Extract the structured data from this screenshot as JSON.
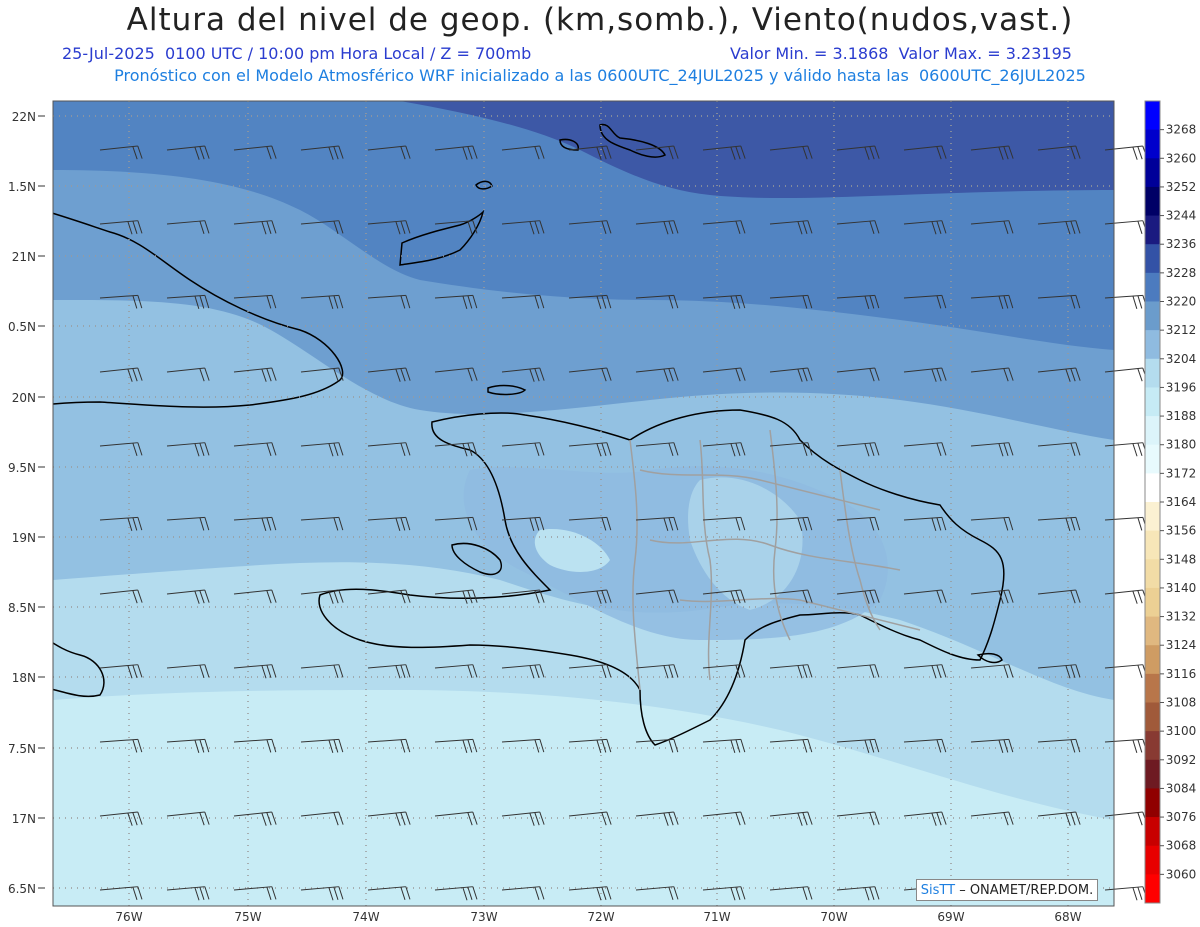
{
  "header": {
    "title": "Altura del nivel de geop. (km,somb.), Viento(nudos,vast.)",
    "line1_left": "25-Jul-2025  0100 UTC / 10:00 pm Hora Local / Z = 700mb",
    "line1_right": "Valor Min. = 3.1868  Valor Max. = 3.23195",
    "line2": "Pronóstico con el Modelo Atmosférico WRF inicializado a las 0600UTC_24JUL2025 y válido hasta las  0600UTC_26JUL2025"
  },
  "axes": {
    "lat_labels": [
      "22N",
      "1.5N",
      "21N",
      "0.5N",
      "20N",
      "9.5N",
      "19N",
      "8.5N",
      "18N",
      "7.5N",
      "17N",
      "6.5N"
    ],
    "lon_labels": [
      "76W",
      "75W",
      "74W",
      "73W",
      "72W",
      "71W",
      "70W",
      "69W",
      "68W"
    ]
  },
  "colorbar": {
    "labels": [
      "3268",
      "3260",
      "3252",
      "3244",
      "3236",
      "3228",
      "3220",
      "3212",
      "3204",
      "3196",
      "3188",
      "3180",
      "3172",
      "3164",
      "3156",
      "3148",
      "3140",
      "3132",
      "3124",
      "3116",
      "3108",
      "3100",
      "3092",
      "3084",
      "3076",
      "3068",
      "3060"
    ],
    "colors": [
      "#0000ff",
      "#0000cc",
      "#000099",
      "#000066",
      "#1a1a80",
      "#3352a6",
      "#4c7bbf",
      "#6b9ccc",
      "#8fbbe0",
      "#b4dcee",
      "#c6ebf5",
      "#dcf4fa",
      "#e8fafd",
      "#ffffff",
      "#fbf1d2",
      "#f7e6b8",
      "#f2dca6",
      "#ecd094",
      "#e0b880",
      "#cf9c63",
      "#b8764a",
      "#a05a3a",
      "#883a32",
      "#6e1a22",
      "#900000",
      "#c80000",
      "#e80000",
      "#ff0000"
    ]
  },
  "credit": {
    "sis": "SisTT",
    "text": " – ONAMET/REP.DOM."
  }
}
